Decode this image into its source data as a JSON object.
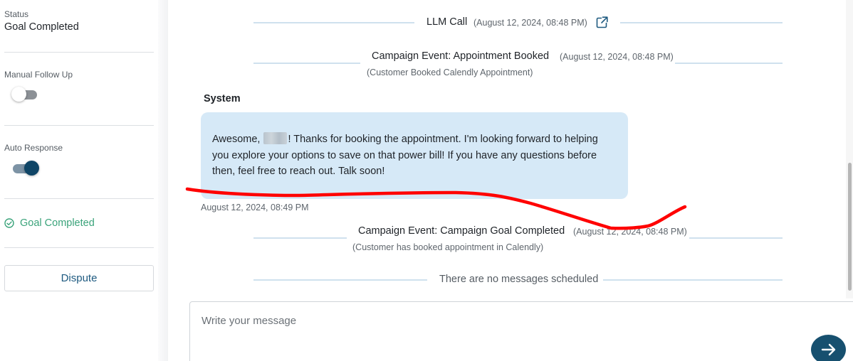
{
  "sidebar": {
    "status_label": "Status",
    "status_value": "Goal Completed",
    "manual_follow_up_label": "Manual Follow Up",
    "manual_follow_up_enabled": false,
    "auto_response_label": "Auto Response",
    "auto_response_enabled": true,
    "goal_text": "Goal Completed",
    "dispute_label": "Dispute"
  },
  "timeline": {
    "llm_call": {
      "title": "LLM Call",
      "time": "(August 12, 2024, 08:48 PM)",
      "icon": "external-link-icon"
    },
    "appointment_event": {
      "title": "Campaign Event: Appointment Booked",
      "time": "(August 12, 2024, 08:48 PM)",
      "subtitle": "(Customer Booked Calendly Appointment)"
    },
    "system_message": {
      "sender": "System",
      "text_before": "Awesome, ",
      "text_after": "! Thanks for booking the appointment. I'm looking forward to helping you explore your options to save on that power bill! If you have any questions before then, feel free to reach out. Talk soon!",
      "timestamp": "August 12, 2024, 08:49 PM"
    },
    "goal_event": {
      "title": "Campaign Event: Campaign Goal Completed",
      "time": "(August 12, 2024, 08:48 PM)",
      "subtitle": "(Customer has booked appointment in Calendly)"
    },
    "no_messages": "There are no messages scheduled"
  },
  "composer": {
    "placeholder": "Write your message",
    "value": ""
  },
  "colors": {
    "accent": "#17506f",
    "goal_green": "#3aa37a",
    "bubble": "#d6e9f7",
    "annotation_red": "#ff0000"
  }
}
